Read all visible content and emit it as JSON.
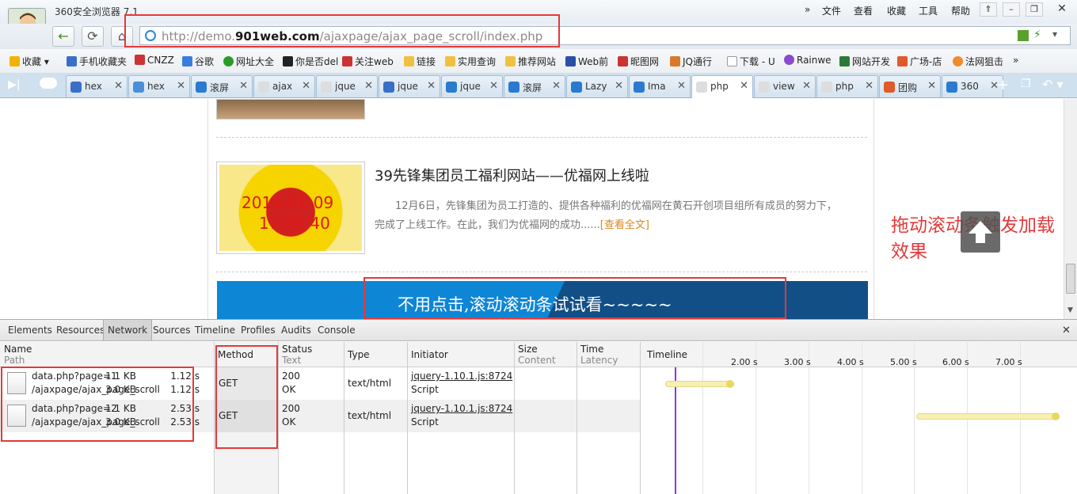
{
  "browser": {
    "title": "360安全浏览器 7.1",
    "menu": [
      "文件",
      "查看",
      "收藏",
      "工具",
      "帮助"
    ],
    "url_prefix": "http://demo.",
    "url_domain": "901web.com",
    "url_path": "/ajaxpage/ajax_page_scroll/index.php",
    "bookmarks": [
      "收藏",
      "手机收藏夹",
      "CNZZ",
      "谷歌",
      "网址大全",
      "你是否del",
      "关注web",
      "链接",
      "实用查询",
      "推荐网站",
      "Web前",
      "昵图网",
      "JQ通行",
      "下载 - U",
      "Rainwe",
      "网站开发",
      "广场-店",
      "法网狙击"
    ],
    "tabs": [
      "hex",
      "hex",
      "滚屏",
      "ajax",
      "jque",
      "jque",
      "jque",
      "滚屏",
      "Lazy",
      "Ima",
      "php",
      "view",
      "php",
      "团购",
      "360"
    ],
    "active_tab_index": 10
  },
  "page": {
    "article_title": "39先锋集团员工福利网站——优福网上线啦",
    "article_body": "12月6日，先锋集团为员工打造的、提供各种福利的优福网在黄石开创项目组所有成员的努力下，完成了上线工作。在此，我们为优福网的成功......",
    "read_more": "[查看全文]",
    "image_date": "2014-01-09",
    "image_time": "17:00:40",
    "banner_text": "不用点击,滚动滚动条试试看~~~~~",
    "annotation": "拖动滚动条触发加载效果"
  },
  "devtools": {
    "tabs": [
      "Elements",
      "Resources",
      "Network",
      "Sources",
      "Timeline",
      "Profiles",
      "Audits",
      "Console"
    ],
    "active_tab": "Network",
    "columns": {
      "name": "Name",
      "name_sub": "Path",
      "method": "Method",
      "status": "Status",
      "status_sub": "Text",
      "type": "Type",
      "initiator": "Initiator",
      "size": "Size",
      "size_sub": "Content",
      "time": "Time",
      "time_sub": "Latency",
      "timeline": "Timeline"
    },
    "timeline_ticks": [
      "2.00 s",
      "3.00 s",
      "4.00 s",
      "5.00 s",
      "6.00 s",
      "7.00 s"
    ],
    "requests": [
      {
        "name": "data.php?page=1",
        "path": "/ajaxpage/ajax_page_scroll",
        "method": "GET",
        "status": "200",
        "status_text": "OK",
        "type": "text/html",
        "initiator": "jquery-1.10.1.js:8724",
        "initiator_sub": "Script",
        "size": "1.1 KB",
        "content": "3.0 KB",
        "time": "1.12 s",
        "latency": "1.12 s"
      },
      {
        "name": "data.php?page=2",
        "path": "/ajaxpage/ajax_page_scroll",
        "method": "GET",
        "status": "200",
        "status_text": "OK",
        "type": "text/html",
        "initiator": "jquery-1.10.1.js:8724",
        "initiator_sub": "Script",
        "size": "1.1 KB",
        "content": "3.0 KB",
        "time": "2.53 s",
        "latency": "2.53 s"
      }
    ]
  },
  "colors": {
    "accent": "#1e90d8",
    "highlight": "#e23a3a",
    "banner": "#0b7ac4",
    "annotation": "#e23a3a"
  }
}
